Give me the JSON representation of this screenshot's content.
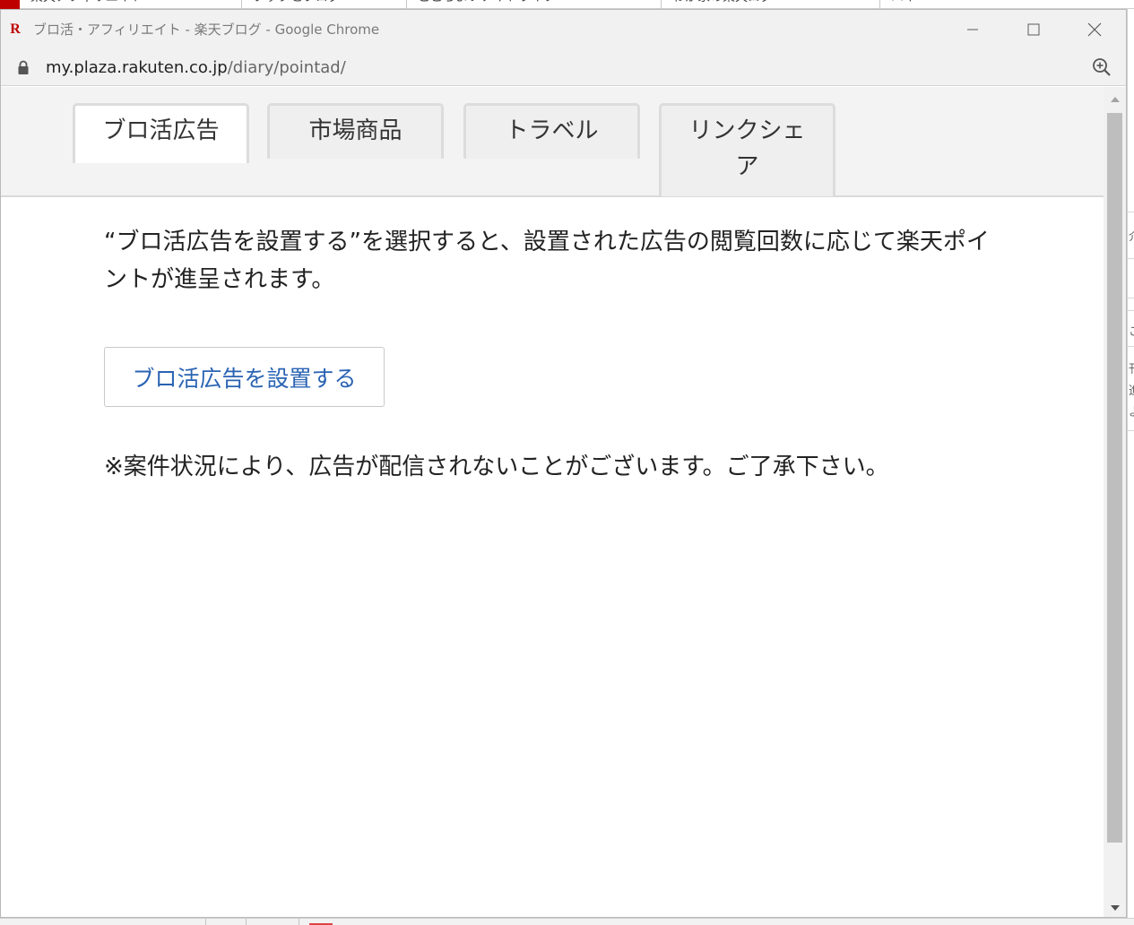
{
  "window": {
    "title": "ブロ活・アフィリエイト - 楽天ブログ - Google Chrome",
    "favicon_letter": "R",
    "brand_color": "#bf0000"
  },
  "address": {
    "domain": "my.plaza.rakuten.co.jp",
    "path": "/diary/pointad/"
  },
  "tabs": [
    {
      "label": "ブロ活広告",
      "active": true
    },
    {
      "label": "市場商品",
      "active": false
    },
    {
      "label": "トラベル",
      "active": false
    },
    {
      "label": "リンクシェア",
      "active": false
    }
  ],
  "content": {
    "description": "“ブロ活広告を設置する”を選択すると、設置された広告の閲覧回数に応じて楽天ポイントが進呈されます。",
    "setup_button": "ブロ活広告を設置する",
    "notice": "※案件状況により、広告が配信されないことがございます。ご了承下さい。",
    "link_color": "#2a63b3"
  },
  "background_window": {
    "tabs": [
      "楽天アフィリエイト",
      "ブックとブログ",
      "ここちよいナイトライフ",
      "わが家の楽天ログ",
      "ハイ"
    ],
    "side_fragments": [
      "介",
      "こ",
      "刊",
      "進",
      "よ"
    ]
  }
}
